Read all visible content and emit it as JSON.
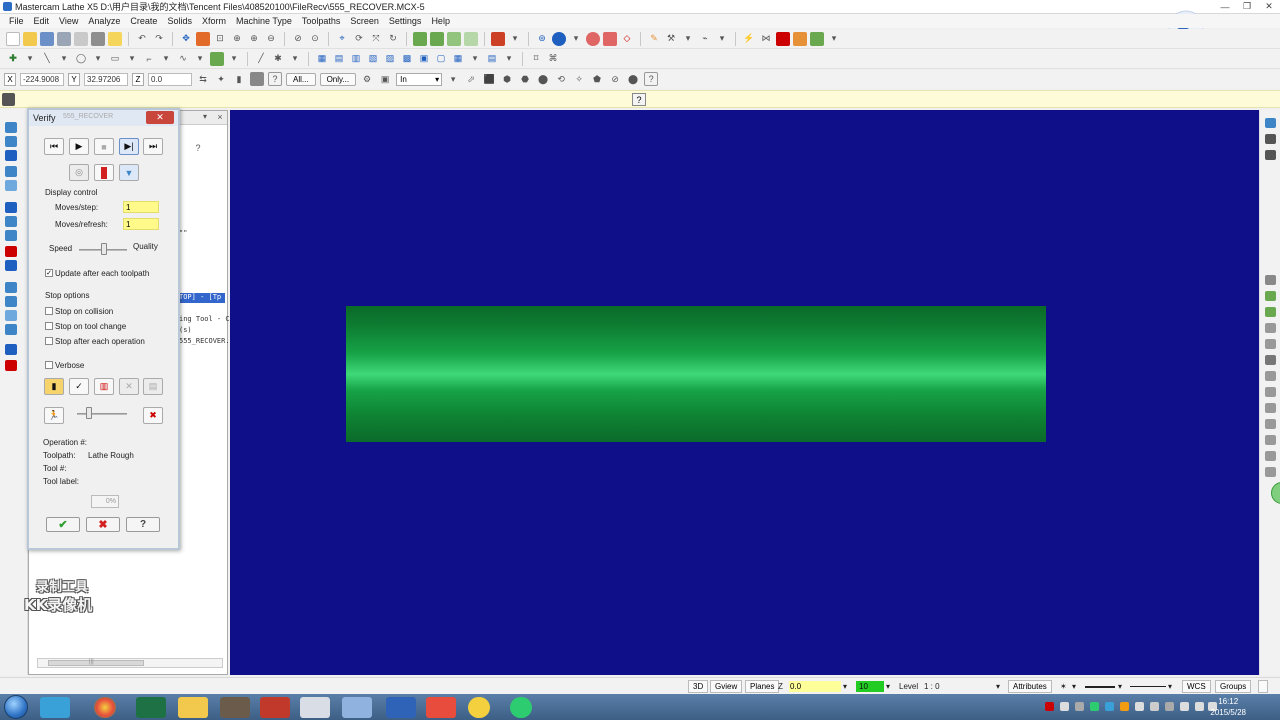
{
  "window": {
    "title": "Mastercam Lathe X5  D:\\用户目录\\我的文档\\Tencent Files\\408520100\\FileRecv\\555_RECOVER.MCX-5",
    "controls": [
      "—",
      "❐",
      "✕"
    ]
  },
  "menu": [
    "File",
    "Edit",
    "View",
    "Analyze",
    "Create",
    "Solids",
    "Xform",
    "Machine Type",
    "Toolpaths",
    "Screen",
    "Settings",
    "Help"
  ],
  "coords": {
    "x_label": "X",
    "x_value": "-224.9008",
    "y_label": "Y",
    "y_value": "32.97206",
    "z_label": "Z",
    "z_value": "0.0",
    "all_button": "All...",
    "only_button": "Only...",
    "units_select": "In"
  },
  "manager": {
    "code_line_1": "\"\"",
    "selected_line": "TOP] - [Tp",
    "code_line_2": "ing Tool - C",
    "code_line_3": "(s)",
    "code_line_4": "555_RECOVER.",
    "scroll_mark": "|||"
  },
  "verify": {
    "title": "Verify",
    "ghost_title": "555_RECOVER",
    "close": "✕",
    "display_control": "Display control",
    "moves_step_label": "Moves/step:",
    "moves_step_value": "1",
    "moves_refresh_label": "Moves/refresh:",
    "moves_refresh_value": "1",
    "speed_label": "Speed",
    "quality_label": "Quality",
    "update_after_toolpath": "Update after each toolpath",
    "stop_options": "Stop options",
    "stop_on_collision": "Stop on collision",
    "stop_on_tool_change": "Stop on tool change",
    "stop_after_operation": "Stop after each operation",
    "verbose": "Verbose",
    "operation_label": "Operation #:",
    "toolpath_label": "Toolpath:",
    "toolpath_value": "Lathe Rough",
    "tool_label": "Tool #:",
    "tool_label_label": "Tool label:",
    "progress": "0%"
  },
  "watermark": {
    "line1": "录制工具",
    "line2": "KK录像机"
  },
  "status": {
    "btn_3d": "3D",
    "btn_gview": "Gview",
    "btn_planes": "Planes",
    "z_label": "Z",
    "z_value": "0.0",
    "color_value": "10",
    "level_label": "Level",
    "level_value": "1 : 0",
    "attributes": "Attributes",
    "wcs": "WCS",
    "groups": "Groups"
  },
  "clock": {
    "time": "16:12",
    "date": "2015/5/28"
  }
}
